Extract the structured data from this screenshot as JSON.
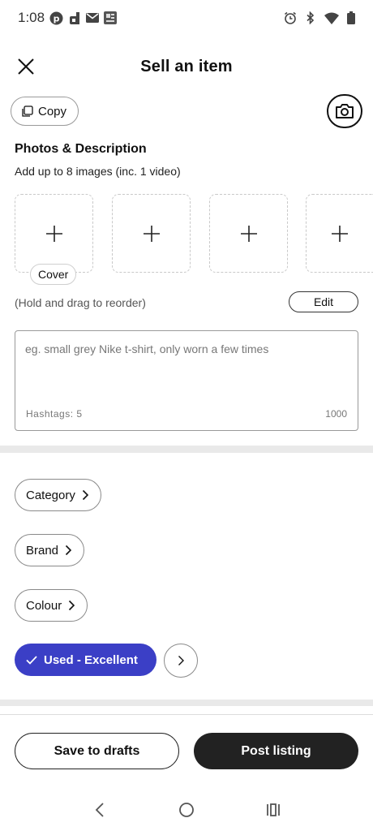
{
  "status_bar": {
    "time": "1:08",
    "icons_left": [
      "pinterest-icon",
      "depop-icon",
      "mail-icon",
      "news-icon"
    ],
    "icons_right": [
      "alarm-icon",
      "bluetooth-icon",
      "wifi-icon",
      "battery-icon"
    ]
  },
  "header": {
    "title": "Sell an item",
    "close_icon": "close-icon"
  },
  "toolbar": {
    "copy_label": "Copy",
    "camera_icon": "camera-icon"
  },
  "photos": {
    "section_title": "Photos & Description",
    "subtitle": "Add up to 8 images (inc. 1 video)",
    "slots": [
      "+",
      "+",
      "+",
      "+"
    ],
    "cover_label": "Cover",
    "reorder_hint": "(Hold and drag to reorder)",
    "edit_label": "Edit"
  },
  "description": {
    "placeholder": "eg. small grey Nike t-shirt, only worn a few times",
    "hashtags": "Hashtags: 5",
    "char_limit": "1000"
  },
  "attributes": {
    "category_label": "Category",
    "brand_label": "Brand",
    "colour_label": "Colour",
    "condition_label": "Used - Excellent",
    "condition_color": "#3b3fc6"
  },
  "actions": {
    "save_drafts_label": "Save to drafts",
    "post_listing_label": "Post listing"
  },
  "system_nav": {
    "icons": [
      "back-icon",
      "home-icon",
      "recents-icon"
    ]
  }
}
